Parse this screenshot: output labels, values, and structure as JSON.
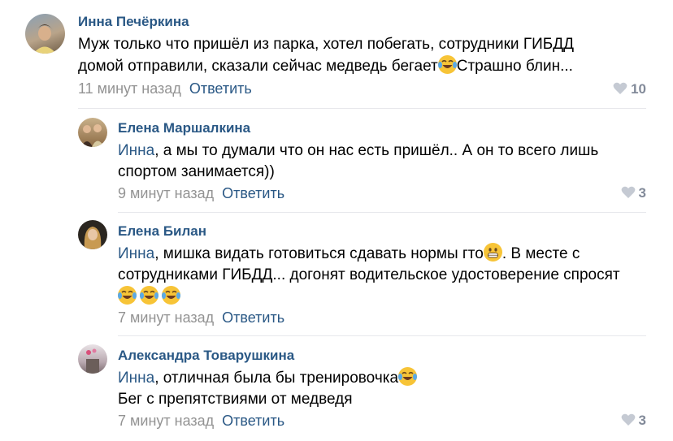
{
  "comments": [
    {
      "author": "Инна Печёркина",
      "line1": "Муж только что пришёл из парка, хотел побегать, сотрудники ГИБДД",
      "line2a": "домой отправили, сказали сейчас медведь бегает",
      "line2b": "Страшно блин...",
      "time": "11 минут назад",
      "reply": "Ответить",
      "likes": "10"
    },
    {
      "author": "Елена Маршалкина",
      "mention": "Инна",
      "line1": ", а мы то думали что он нас есть пришёл.. А он то всего лишь",
      "line2": "спортом занимается))",
      "time": "9 минут назад",
      "reply": "Ответить",
      "likes": "3"
    },
    {
      "author": "Елена Билан",
      "mention": "Инна",
      "line1a": ", мишка видать готовиться сдавать нормы гто",
      "line1b": ". В месте с",
      "line2": "сотрудниками ГИБДД... догонят водительское удостоверение спросят",
      "time": "7 минут назад",
      "reply": "Ответить"
    },
    {
      "author": "Александра Товарушкина",
      "mention": "Инна",
      "line1": ", отличная была бы тренировочка",
      "line2": "Бег с препятствиями от медведя",
      "time": "7 минут назад",
      "reply": "Ответить",
      "likes": "3"
    }
  ],
  "colors": {
    "link": "#2a5885",
    "meta": "#939393",
    "like": "#828a99",
    "divider": "#e7e8ec"
  },
  "icons": [
    "heart-icon",
    "tears-of-joy-emoji",
    "grinning-emoji"
  ]
}
